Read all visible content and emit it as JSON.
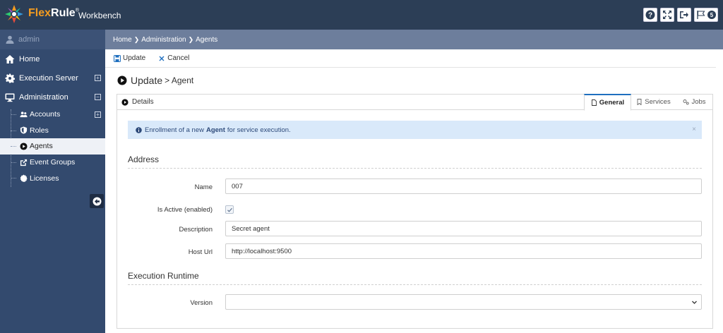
{
  "app": {
    "brand_part1": "Flex",
    "brand_part2": "Rule",
    "brand_mark": "®",
    "subtitle": "Workbench",
    "notifications_count": "5",
    "colors": {
      "topbar": "#2c3e56",
      "sidebar": "#334a6e",
      "accent": "#f39c20",
      "tab_active": "#1f6fbf"
    }
  },
  "topbar_icons": [
    "help-icon",
    "fullscreen-icon",
    "logout-icon",
    "flag-icon"
  ],
  "sidebar": {
    "user": "admin",
    "items": [
      {
        "label": "Home",
        "icon": "home-icon"
      },
      {
        "label": "Execution Server",
        "icon": "gear-icon",
        "expand": "+"
      },
      {
        "label": "Administration",
        "icon": "monitor-icon",
        "expand": "−"
      }
    ],
    "subitems": [
      {
        "label": "Accounts",
        "icon": "users-icon",
        "expand": "+"
      },
      {
        "label": "Roles",
        "icon": "shield-icon"
      },
      {
        "label": "Agents",
        "icon": "play-circle-icon",
        "active": true
      },
      {
        "label": "Event Groups",
        "icon": "external-link-icon"
      },
      {
        "label": "Licenses",
        "icon": "certificate-icon"
      }
    ]
  },
  "breadcrumb": {
    "items": [
      "Home",
      "Administration",
      "Agents"
    ]
  },
  "toolbar": {
    "update_label": "Update",
    "cancel_label": "Cancel"
  },
  "page": {
    "title": "Update",
    "subtitle": "> Agent"
  },
  "panel": {
    "title": "Details",
    "tabs": [
      {
        "label": "General",
        "icon": "file-icon",
        "active": true
      },
      {
        "label": "Services",
        "icon": "bookmark-icon"
      },
      {
        "label": "Jobs",
        "icon": "gears-icon"
      }
    ]
  },
  "alert": {
    "prefix": "Enrollment of a new",
    "bold": "Agent",
    "suffix": "for service execution.",
    "close": "×"
  },
  "sections": {
    "address": "Address",
    "runtime": "Execution Runtime"
  },
  "form": {
    "name_label": "Name",
    "name_value": "007",
    "active_label": "Is Active (enabled)",
    "active_checked": true,
    "description_label": "Description",
    "description_value": "Secret agent",
    "hosturl_label": "Host Url",
    "hosturl_value": "http://localhost:9500",
    "version_label": "Version",
    "version_value": ""
  }
}
